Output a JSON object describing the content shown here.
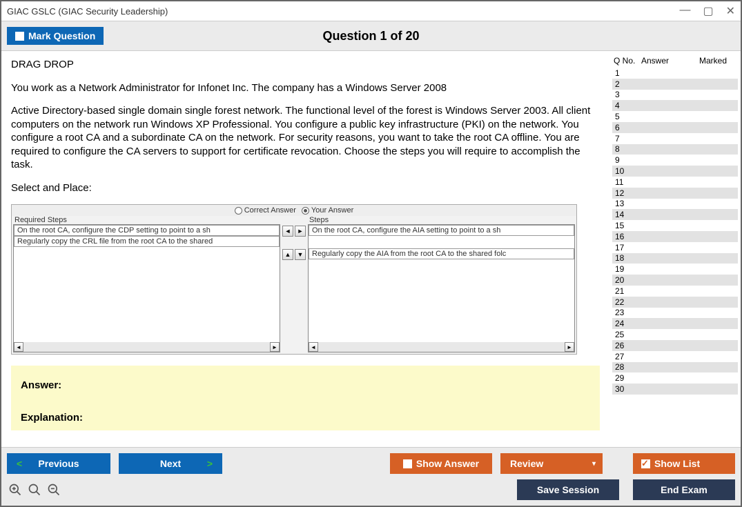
{
  "window": {
    "title": "GIAC GSLC (GIAC Security Leadership)"
  },
  "header": {
    "mark_label": "Mark Question",
    "question_of": "Question 1 of 20"
  },
  "question": {
    "instruction": "DRAG DROP",
    "line1": "You work as a Network Administrator for Infonet Inc. The company has a Windows Server 2008",
    "line2": "Active Directory-based single domain single forest network. The functional level of the forest is Windows Server 2003. All client computers on the network run Windows XP Professional. You configure a public key infrastructure (PKI) on the network. You configure a root CA and a subordinate CA on the network. For security reasons, you want to take the root CA offline. You are required to configure the CA servers to support for certificate revocation. Choose the steps you will require to accomplish the task.",
    "select": "Select and Place:"
  },
  "dragdrop": {
    "correct_label": "Correct Answer",
    "your_label": "Your Answer",
    "left_header": "Required Steps",
    "right_header": "Steps",
    "left_item1": "On the root CA, configure the CDP setting to point to a sh",
    "left_item2": "Regularly copy the CRL file from the root CA to the shared",
    "right_item1": "On the root CA, configure the AIA setting to point to a sh",
    "right_item2": "Regularly copy the AIA from the root CA to the shared folc"
  },
  "answer_box": {
    "answer": "Answer:",
    "explanation": "Explanation:"
  },
  "sidebar": {
    "h1": "Q No.",
    "h2": "Answer",
    "h3": "Marked",
    "rows": [
      1,
      2,
      3,
      4,
      5,
      6,
      7,
      8,
      9,
      10,
      11,
      12,
      13,
      14,
      15,
      16,
      17,
      18,
      19,
      20,
      21,
      22,
      23,
      24,
      25,
      26,
      27,
      28,
      29,
      30
    ]
  },
  "buttons": {
    "previous": "Previous",
    "next": "Next",
    "show_answer": "Show Answer",
    "review": "Review",
    "show_list": "Show List",
    "save_session": "Save Session",
    "end_exam": "End Exam"
  }
}
